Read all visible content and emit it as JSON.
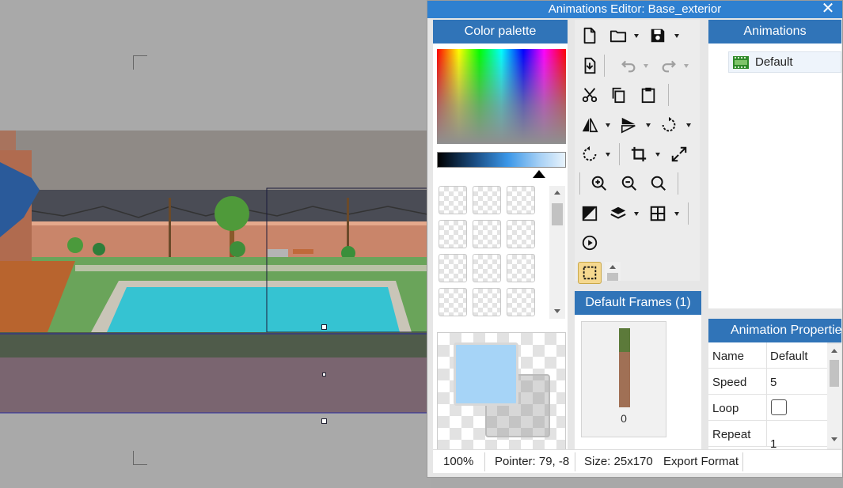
{
  "window": {
    "title": "Animations Editor: Base_exterior",
    "close_glyph": "✕"
  },
  "color_palette": {
    "title": "Color palette",
    "primary_color": "#a6d4f7",
    "secondary_color": "#8c8c8c"
  },
  "frames": {
    "title": "Default Frames (1)",
    "frame_index": "0"
  },
  "animations": {
    "title": "Animations",
    "items": [
      {
        "name": "Default",
        "icon": "film-icon"
      }
    ]
  },
  "properties": {
    "title": "Animation Properties",
    "rows": [
      {
        "name": "Name",
        "value": "Default"
      },
      {
        "name": "Speed",
        "value": "5"
      },
      {
        "name": "Loop",
        "value": ""
      },
      {
        "name": "Repeat",
        "value": "1"
      }
    ]
  },
  "status": {
    "zoom": "100%",
    "pointer": "Pointer: 79, -8",
    "size": "Size: 25x170",
    "export": "Export Format"
  },
  "toolbar": [
    "new-file-icon",
    "open-folder-icon",
    "save-icon",
    "import-icon",
    "undo-icon",
    "redo-icon",
    "cut-icon",
    "copy-icon",
    "paste-icon",
    "flip-horizontal-icon",
    "flip-vertical-icon",
    "rotate-icon",
    "rotate-right-icon",
    "crop-icon",
    "resize-icon",
    "zoom-in-icon",
    "zoom-out-icon",
    "zoom-reset-icon",
    "contrast-icon",
    "layers-icon",
    "grid-icon",
    "play-icon",
    "selection-icon"
  ],
  "colors": {
    "accent": "#3074b8",
    "titlebar": "#2f80d0",
    "selection_tool": "#f5d88f"
  }
}
